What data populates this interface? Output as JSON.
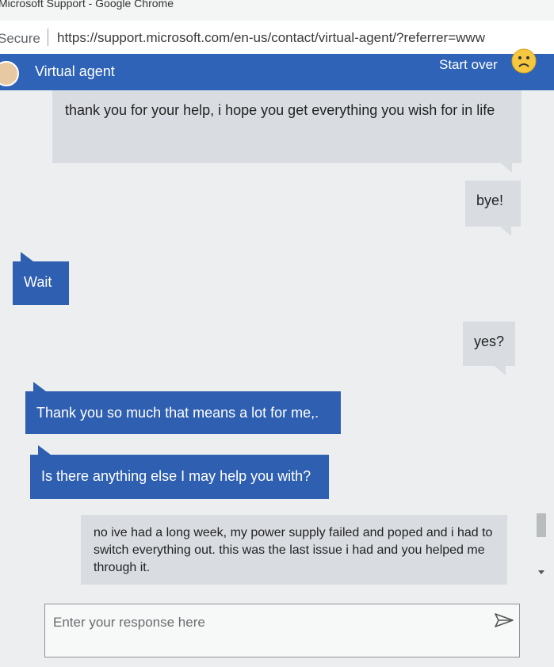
{
  "window": {
    "title": "Microsoft Support - Google Chrome"
  },
  "addressbar": {
    "security_label": "Secure",
    "url": "https://support.microsoft.com/en-us/contact/virtual-agent/?referrer=www"
  },
  "header": {
    "title": "Virtual agent",
    "start_over": "Start over",
    "mood_icon": "sad-face-icon"
  },
  "messages": [
    {
      "from": "user",
      "text": "thank you for your help, i hope you get everything you wish for in life"
    },
    {
      "from": "user",
      "text": "bye!"
    },
    {
      "from": "agent",
      "text": "Wait"
    },
    {
      "from": "user",
      "text": "yes?"
    },
    {
      "from": "agent",
      "text": "Thank you so much that means a lot for me,."
    },
    {
      "from": "agent",
      "text": "Is there anything else I may help you with?"
    },
    {
      "from": "user",
      "text": "no ive had a long week, my power supply failed and poped and i had to switch everything out. this was the last issue i had and you helped me through it."
    }
  ],
  "composer": {
    "placeholder": "Enter your response here",
    "send_icon": "send-icon"
  },
  "colors": {
    "header_bg": "#2f63b7",
    "agent_bubble": "#2f5fb0",
    "user_bubble": "#d9dde2"
  }
}
